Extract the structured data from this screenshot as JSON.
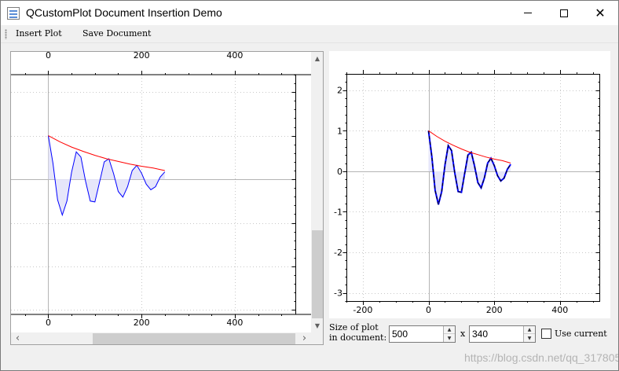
{
  "window": {
    "title": "QCustomPlot Document Insertion Demo",
    "controls": {
      "minimize": "—",
      "maximize": "□",
      "close": "✕"
    }
  },
  "toolbar": {
    "insert_label": "Insert Plot",
    "save_label": "Save Document"
  },
  "document_plot": {
    "top_ticks": [
      "0",
      "200",
      "400"
    ],
    "bottom_ticks": [
      "0",
      "200",
      "400"
    ]
  },
  "preview_plot": {
    "x_ticks": [
      "-200",
      "0",
      "200",
      "400"
    ],
    "y_ticks": [
      "2",
      "1",
      "0",
      "-1",
      "-2",
      "-3"
    ]
  },
  "size_controls": {
    "label_line1": "Size of plot",
    "label_line2": "in document:",
    "width_value": "500",
    "times": "x",
    "height_value": "340",
    "use_current_label": "Use current",
    "use_current_checked": false
  },
  "watermark": "https://blog.csdn.net/qq_31780503",
  "chart_data": [
    {
      "type": "line",
      "panel": "document",
      "series": [
        {
          "role": "data",
          "color": "#0000ff",
          "fill": "#e6e6fa",
          "x": [
            0,
            10,
            20,
            30,
            40,
            50,
            60,
            70,
            80,
            90,
            100,
            110,
            120,
            130,
            140,
            150,
            160,
            170,
            180,
            190,
            200,
            210,
            220,
            230,
            240,
            250
          ],
          "y": [
            1.0,
            0.37,
            -0.47,
            -0.82,
            -0.5,
            0.16,
            0.63,
            0.51,
            -0.05,
            -0.5,
            -0.52,
            -0.06,
            0.4,
            0.47,
            0.13,
            -0.28,
            -0.41,
            -0.17,
            0.2,
            0.32,
            0.14,
            -0.11,
            -0.24,
            -0.17,
            0.05,
            0.17
          ]
        },
        {
          "role": "envelope",
          "color": "#ff0000",
          "x": [
            0,
            25,
            50,
            75,
            100,
            125,
            150,
            175,
            200,
            225,
            250
          ],
          "y": [
            1.0,
            0.86,
            0.74,
            0.64,
            0.55,
            0.47,
            0.41,
            0.35,
            0.3,
            0.26,
            0.2
          ]
        }
      ],
      "xlim": [
        -80,
        530
      ],
      "ylim": [
        -3.1,
        2.4
      ],
      "x_ticks": [
        0,
        200,
        400
      ],
      "grid": true
    },
    {
      "type": "line",
      "panel": "preview",
      "series": [
        {
          "role": "data",
          "color": "#0000ff",
          "fill": "#e6e6fa",
          "x": [
            0,
            10,
            20,
            30,
            40,
            50,
            60,
            70,
            80,
            90,
            100,
            110,
            120,
            130,
            140,
            150,
            160,
            170,
            180,
            190,
            200,
            210,
            220,
            230,
            240,
            250
          ],
          "y": [
            1.0,
            0.37,
            -0.47,
            -0.82,
            -0.5,
            0.16,
            0.63,
            0.51,
            -0.05,
            -0.5,
            -0.52,
            -0.06,
            0.4,
            0.47,
            0.13,
            -0.28,
            -0.41,
            -0.17,
            0.2,
            0.32,
            0.14,
            -0.11,
            -0.24,
            -0.17,
            0.05,
            0.17
          ]
        },
        {
          "role": "envelope",
          "color": "#ff0000",
          "x": [
            0,
            25,
            50,
            75,
            100,
            125,
            150,
            175,
            200,
            225,
            250
          ],
          "y": [
            1.0,
            0.86,
            0.74,
            0.64,
            0.55,
            0.47,
            0.41,
            0.35,
            0.3,
            0.26,
            0.2
          ]
        }
      ],
      "xlim": [
        -250,
        520
      ],
      "ylim": [
        -3.2,
        2.4
      ],
      "x_ticks": [
        -200,
        0,
        200,
        400
      ],
      "y_ticks": [
        2,
        1,
        0,
        -1,
        -2,
        -3
      ],
      "grid": true
    }
  ]
}
